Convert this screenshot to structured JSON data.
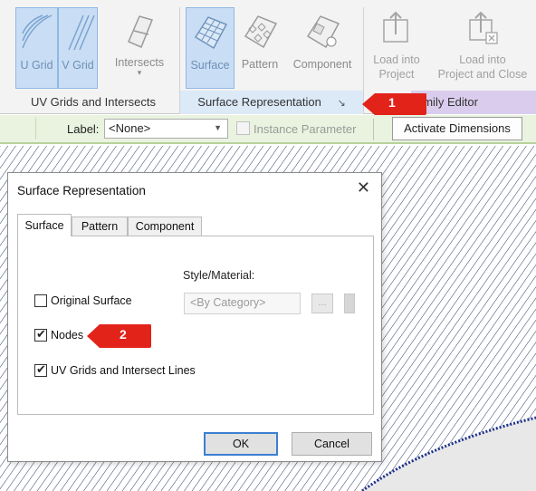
{
  "ribbon": {
    "buttons": [
      {
        "id": "u-grid",
        "label": "U Grid",
        "active": true
      },
      {
        "id": "v-grid",
        "label": "V Grid",
        "active": true
      },
      {
        "id": "intersects",
        "label": "Intersects",
        "sub": "▾",
        "active": false
      },
      {
        "id": "surface",
        "label": "Surface",
        "active": true
      },
      {
        "id": "pattern",
        "label": "Pattern",
        "active": false
      },
      {
        "id": "component",
        "label": "Component",
        "active": false
      },
      {
        "id": "load-into-project",
        "label": "Load into Project",
        "line1": "Load into",
        "line2": "Project",
        "active": false
      },
      {
        "id": "load-into-project-close",
        "label": "Load into Project and Close",
        "line1": "Load into",
        "line2": "Project and Close",
        "active": false
      }
    ],
    "panels": {
      "uv_grids": "UV Grids and Intersects",
      "surface_rep": "Surface Representation",
      "surface_rep_launcher": "↘",
      "family_editor": "amily Editor"
    }
  },
  "options_bar": {
    "label_text": "Label:",
    "label_value": "<None>",
    "instance_parameter": "Instance Parameter",
    "activate_dimensions": "Activate Dimensions"
  },
  "dialog": {
    "title": "Surface Representation",
    "close": "✕",
    "tabs": [
      "Surface",
      "Pattern",
      "Component"
    ],
    "selected_tab": "Surface",
    "style_material_label": "Style/Material:",
    "style_material_value": "<By Category>",
    "browse_button": "...",
    "checkboxes": [
      {
        "label": "Original Surface",
        "checked": false
      },
      {
        "label": "Nodes",
        "checked": true
      },
      {
        "label": "UV Grids and Intersect Lines",
        "checked": true
      }
    ],
    "ok": "OK",
    "cancel": "Cancel"
  },
  "callouts": [
    "1",
    "2"
  ],
  "colors": {
    "callout_red": "#e2231a",
    "ribbon_active": "#c9def5",
    "options_bar": "#e9f3df",
    "family_editor_panel": "#d9ccec"
  }
}
